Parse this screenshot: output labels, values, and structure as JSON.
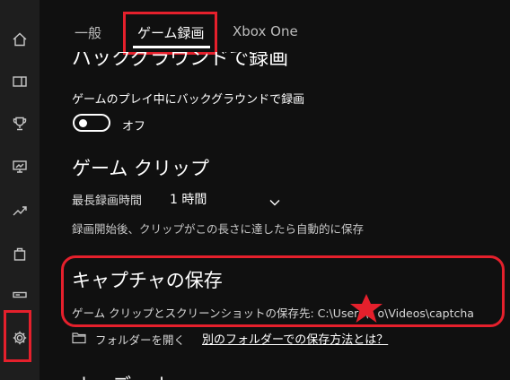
{
  "sidebar": {
    "items": [
      {
        "icon": "home-icon"
      },
      {
        "icon": "game-bar-icon"
      },
      {
        "icon": "achievements-icon"
      },
      {
        "icon": "broadcasting-icon"
      },
      {
        "icon": "trending-icon"
      },
      {
        "icon": "store-icon"
      },
      {
        "icon": "connection-icon"
      },
      {
        "icon": "gear-icon"
      }
    ]
  },
  "tabs": [
    {
      "label": "一般"
    },
    {
      "label": "ゲーム録画"
    },
    {
      "label": "Xbox One"
    }
  ],
  "background_recording": {
    "heading": "バックグラウンドで録画",
    "toggle_label": "ゲームのプレイ中にバックグラウンドで録画",
    "toggle_state": "オフ"
  },
  "game_clip": {
    "heading": "ゲーム クリップ",
    "max_length_label": "最長録画時間",
    "max_length_value": "1 時間",
    "description": "録画開始後、クリップがこの長さに達したら自動的に保存"
  },
  "capture_save": {
    "heading": "キャプチャの保存",
    "path_text": "ゲーム クリップとスクリーンショットの保存先: C:\\Users\\s      o\\Videos\\captcha",
    "open_folder": "フォルダーを開く",
    "other_folder_link": "別のフォルダーでの保存方法とは？"
  },
  "next_heading": "オーディオ",
  "colors": {
    "highlight": "#e5202c",
    "background": "#101010",
    "sidebar": "#1e1e1e"
  }
}
